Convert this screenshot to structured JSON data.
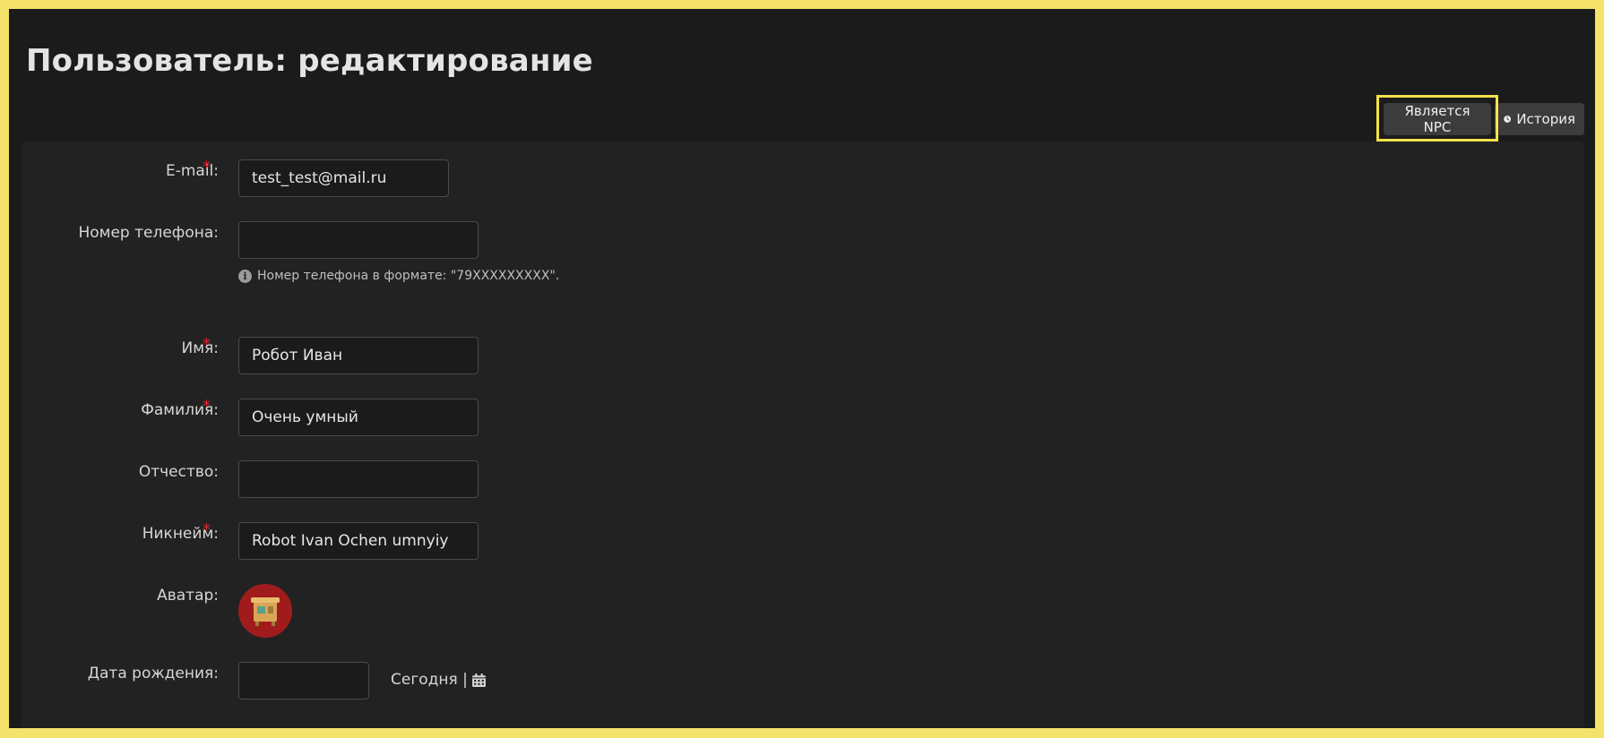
{
  "page": {
    "title": "Пользователь: редактирование"
  },
  "toolbar": {
    "npc_label": "Является NPC",
    "history_label": "История"
  },
  "form": {
    "email": {
      "label": "E-mail:",
      "value": "test_test@mail.ru",
      "required": true
    },
    "phone": {
      "label": "Номер телефона:",
      "value": "",
      "hint": "Номер телефона в формате: \"79XXXXXXXXX\".",
      "required": false
    },
    "first_name": {
      "label": "Имя:",
      "value": "Робот Иван",
      "required": true
    },
    "last_name": {
      "label": "Фамилия:",
      "value": "Очень умный",
      "required": true
    },
    "patronymic": {
      "label": "Отчество:",
      "value": "",
      "required": false
    },
    "nickname": {
      "label": "Никнейм:",
      "value": "Robot Ivan Ochen umnyiy",
      "required": true
    },
    "avatar": {
      "label": "Аватар:"
    },
    "birthdate": {
      "label": "Дата рождения:",
      "value": "",
      "today_label": "Сегодня |"
    }
  },
  "colors": {
    "highlight": "#f2e24a",
    "arrow": "#d83a4e",
    "required": "#d9282f"
  },
  "icons": {
    "history": "clock-icon",
    "hint": "info-icon",
    "date": "calendar-icon"
  }
}
